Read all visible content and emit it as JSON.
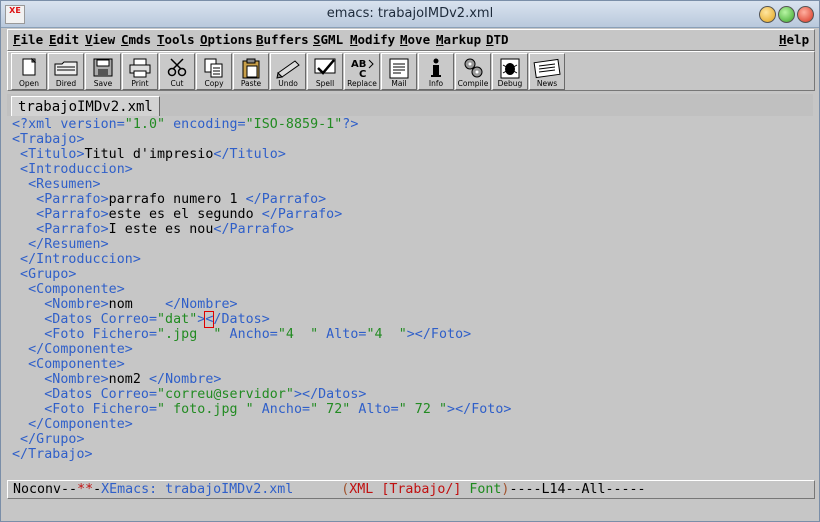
{
  "window": {
    "title": "emacs: trabajoIMDv2.xml",
    "app_icon_text": "XE"
  },
  "menubar": {
    "items": [
      "File",
      "Edit",
      "View",
      "Cmds",
      "Tools",
      "Options",
      "Buffers",
      "SGML",
      "Modify",
      "Move",
      "Markup",
      "DTD"
    ],
    "help": "Help"
  },
  "toolbar": {
    "buttons": [
      {
        "label": "Open",
        "icon": "open-icon"
      },
      {
        "label": "Dired",
        "icon": "dired-icon"
      },
      {
        "label": "Save",
        "icon": "save-icon"
      },
      {
        "label": "Print",
        "icon": "print-icon"
      },
      {
        "label": "Cut",
        "icon": "cut-icon"
      },
      {
        "label": "Copy",
        "icon": "copy-icon"
      },
      {
        "label": "Paste",
        "icon": "paste-icon"
      },
      {
        "label": "Undo",
        "icon": "undo-icon"
      },
      {
        "label": "Spell",
        "icon": "spell-icon"
      },
      {
        "label": "Replace",
        "icon": "replace-icon"
      },
      {
        "label": "Mail",
        "icon": "mail-icon"
      },
      {
        "label": "Info",
        "icon": "info-icon"
      },
      {
        "label": "Compile",
        "icon": "compile-icon"
      },
      {
        "label": "Debug",
        "icon": "debug-icon"
      },
      {
        "label": "News",
        "icon": "news-icon"
      }
    ]
  },
  "tabs": [
    {
      "label": "trabajoIMDv2.xml",
      "active": true
    }
  ],
  "editor": {
    "lines": [
      [
        [
          "t-tag",
          "<?xml version="
        ],
        [
          "t-str",
          "\"1.0\""
        ],
        [
          "t-tag",
          " encoding="
        ],
        [
          "t-str",
          "\"ISO-8859-1\""
        ],
        [
          "t-tag",
          "?>"
        ]
      ],
      [
        [
          "t-tag",
          "<Trabajo>"
        ]
      ],
      [
        [
          "t-tag",
          " <Titulo>"
        ],
        [
          "t-text",
          "Titul d'impresio"
        ],
        [
          "t-tag",
          "</Titulo>"
        ]
      ],
      [
        [
          "t-tag",
          " <Introduccion>"
        ]
      ],
      [
        [
          "t-tag",
          "  <Resumen>"
        ]
      ],
      [
        [
          "t-tag",
          "   <Parrafo>"
        ],
        [
          "t-text",
          "parrafo numero 1 "
        ],
        [
          "t-tag",
          "</Parrafo>"
        ]
      ],
      [
        [
          "t-tag",
          "   <Parrafo>"
        ],
        [
          "t-text",
          "este es el segundo "
        ],
        [
          "t-tag",
          "</Parrafo>"
        ]
      ],
      [
        [
          "t-tag",
          "   <Parrafo>"
        ],
        [
          "t-text",
          "I este es nou"
        ],
        [
          "t-tag",
          "</Parrafo>"
        ]
      ],
      [
        [
          "t-tag",
          "  </Resumen>"
        ]
      ],
      [
        [
          "t-tag",
          " </Introduccion>"
        ]
      ],
      [
        [
          "t-tag",
          " <Grupo>"
        ]
      ],
      [
        [
          "t-tag",
          "  <Componente>"
        ]
      ],
      [
        [
          "t-tag",
          "    <Nombre>"
        ],
        [
          "t-text",
          "nom    "
        ],
        [
          "t-tag",
          "</Nombre>"
        ]
      ],
      [
        [
          "t-tag",
          "    <Datos Correo="
        ],
        [
          "t-str",
          "\"dat\""
        ],
        [
          "t-tag",
          ">"
        ],
        [
          "cursor",
          "<"
        ],
        [
          "t-tag",
          "/Datos>"
        ]
      ],
      [
        [
          "t-tag",
          "    <Foto Fichero="
        ],
        [
          "t-str",
          "\".jpg  \""
        ],
        [
          "t-tag",
          " Ancho="
        ],
        [
          "t-str",
          "\"4  \""
        ],
        [
          "t-tag",
          " Alto="
        ],
        [
          "t-str",
          "\"4  \""
        ],
        [
          "t-tag",
          "></Foto>"
        ]
      ],
      [
        [
          "t-tag",
          "  </Componente>"
        ]
      ],
      [
        [
          "t-tag",
          "  <Componente>"
        ]
      ],
      [
        [
          "t-tag",
          "    <Nombre>"
        ],
        [
          "t-text",
          "nom2 "
        ],
        [
          "t-tag",
          "</Nombre>"
        ]
      ],
      [
        [
          "t-tag",
          "    <Datos Correo="
        ],
        [
          "t-str",
          "\"correu@servidor\""
        ],
        [
          "t-tag",
          "></Datos>"
        ]
      ],
      [
        [
          "t-tag",
          "    <Foto Fichero="
        ],
        [
          "t-str",
          "\" foto.jpg \""
        ],
        [
          "t-tag",
          " Ancho="
        ],
        [
          "t-str",
          "\" 72\""
        ],
        [
          "t-tag",
          " Alto="
        ],
        [
          "t-str",
          "\" 72 \""
        ],
        [
          "t-tag",
          "></Foto>"
        ]
      ],
      [
        [
          "t-tag",
          "  </Componente>"
        ]
      ],
      [
        [
          "t-tag",
          " </Grupo>"
        ]
      ],
      [
        [
          "t-tag",
          "</Trabajo>"
        ]
      ]
    ]
  },
  "modeline": {
    "segments": [
      [
        "ml-black",
        "Noconv"
      ],
      [
        "ml-black",
        "--"
      ],
      [
        "ml-red",
        "**"
      ],
      [
        "ml-black",
        "-"
      ],
      [
        "ml-blue",
        "XEmacs: trabajoIMDv2.xml"
      ],
      [
        "ml-black",
        "      "
      ],
      [
        "ml-brown",
        "("
      ],
      [
        "ml-red",
        "XML "
      ],
      [
        "ml-red",
        "[Trabajo/]"
      ],
      [
        "ml-green",
        " Font"
      ],
      [
        "ml-brown",
        ")"
      ],
      [
        "ml-black",
        "----L14--All-----"
      ]
    ]
  },
  "colors": {
    "tag": "#2f5fc9",
    "string": "#228b22",
    "text": "#000000",
    "cursor_outline": "#e00000",
    "background": "#c6c6c6"
  }
}
